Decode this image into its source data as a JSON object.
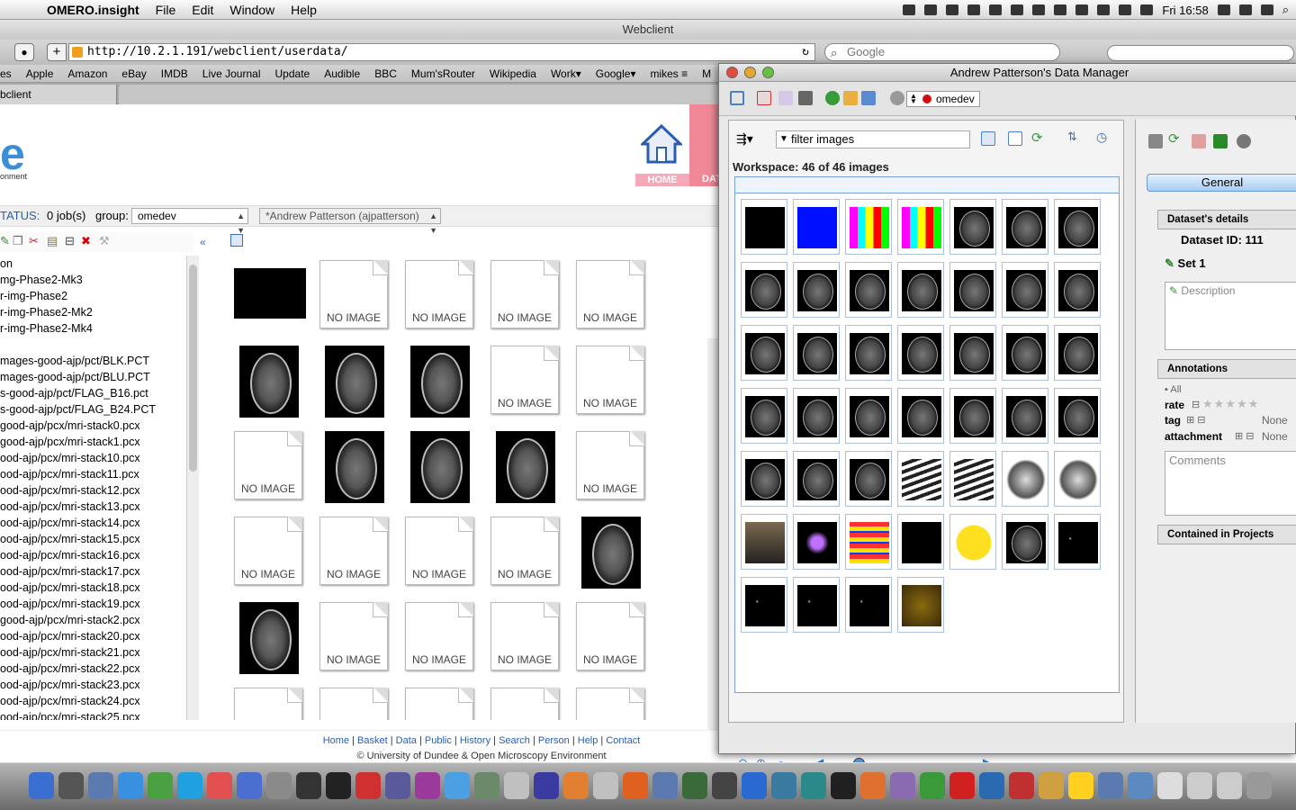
{
  "menubar": {
    "app_name": "OMERO.insight",
    "menus": [
      "File",
      "Edit",
      "Window",
      "Help"
    ],
    "clock": "Fri 16:58"
  },
  "browser": {
    "window_title": "Webclient",
    "url": "http://10.2.1.191/webclient/userdata/",
    "search_placeholder": "Google",
    "bookmarks": [
      "es",
      "Apple",
      "Amazon",
      "eBay",
      "IMDB",
      "Live Journal",
      "Update",
      "Audible",
      "BBC",
      "Mum'sRouter",
      "Wikipedia",
      "Work▾",
      "Google▾",
      "mikes ≡",
      "M"
    ],
    "tab_label": "bclient"
  },
  "webclient": {
    "logo_text": "e",
    "logo_caption": "onment",
    "home_label": "HOME",
    "data_label": "DAT",
    "status_label": "TATUS:",
    "jobs": "0 job(s)",
    "group_label": "group:",
    "group_value": "omedev",
    "user_value": "*Andrew Patterson (ajpatterson)",
    "tree_items": [
      "on",
      "mg-Phase2-Mk3",
      "r-img-Phase2",
      "r-img-Phase2-Mk2",
      "r-img-Phase2-Mk4",
      "",
      "mages-good-ajp/pct/BLK.PCT",
      "mages-good-ajp/pct/BLU.PCT",
      "s-good-ajp/pct/FLAG_B16.pct",
      "s-good-ajp/pct/FLAG_B24.PCT",
      "good-ajp/pcx/mri-stack0.pcx",
      "good-ajp/pcx/mri-stack1.pcx",
      "ood-ajp/pcx/mri-stack10.pcx",
      "ood-ajp/pcx/mri-stack11.pcx",
      "ood-ajp/pcx/mri-stack12.pcx",
      "ood-ajp/pcx/mri-stack13.pcx",
      "ood-ajp/pcx/mri-stack14.pcx",
      "ood-ajp/pcx/mri-stack15.pcx",
      "ood-ajp/pcx/mri-stack16.pcx",
      "ood-ajp/pcx/mri-stack17.pcx",
      "ood-ajp/pcx/mri-stack18.pcx",
      "ood-ajp/pcx/mri-stack19.pcx",
      "good-ajp/pcx/mri-stack2.pcx",
      "ood-ajp/pcx/mri-stack20.pcx",
      "ood-ajp/pcx/mri-stack21.pcx",
      "ood-ajp/pcx/mri-stack22.pcx",
      "ood-ajp/pcx/mri-stack23.pcx",
      "ood-ajp/pcx/mri-stack24.pcx",
      "ood-ajp/pcx/mri-stack25.pcx"
    ],
    "no_image_text": "NO IMAGE",
    "footer_links": [
      "Home",
      "Basket",
      "Data",
      "Public",
      "History",
      "Search",
      "Person",
      "Help",
      "Contact"
    ],
    "footer_copy": "© University of Dundee & Open Microscopy Environment"
  },
  "insight": {
    "window_title": "Andrew Patterson's Data Manager",
    "group": "omedev",
    "filter_text": "filter  images",
    "workspace_label": "Workspace: 46 of 46 images",
    "general_tab": "General",
    "dataset_header": "Dataset's details",
    "dataset_id": "Dataset ID: 111",
    "dataset_name": "Set 1",
    "description_placeholder": "Description",
    "annotations_header": "Annotations",
    "all_label": "All",
    "rate_label": "rate",
    "tag_label": "tag",
    "attachment_label": "attachment",
    "tag_value": "None",
    "attachment_value": "None",
    "comments_placeholder": "Comments",
    "projects_header": "Contained in Projects"
  }
}
